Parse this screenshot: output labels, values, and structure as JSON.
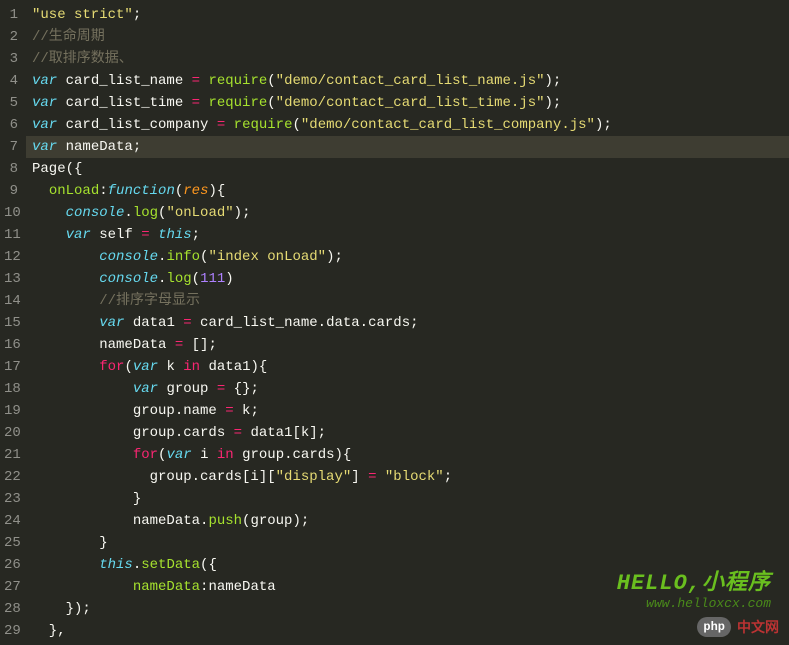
{
  "gutter": {
    "start": 1,
    "end": 29,
    "highlighted": 7
  },
  "code": {
    "lines": [
      [
        [
          "s-str",
          "\"use strict\""
        ],
        [
          "s-id",
          ";"
        ]
      ],
      [
        [
          "s-com",
          "//生命周期"
        ]
      ],
      [
        [
          "s-com",
          "//取排序数据、"
        ]
      ],
      [
        [
          "s-kw",
          "var"
        ],
        [
          "s-id",
          " card_list_name "
        ],
        [
          "s-op",
          "="
        ],
        [
          "s-id",
          " "
        ],
        [
          "s-func",
          "require"
        ],
        [
          "s-id",
          "("
        ],
        [
          "s-str",
          "\"demo/contact_card_list_name.js\""
        ],
        [
          "s-id",
          ");"
        ]
      ],
      [
        [
          "s-kw",
          "var"
        ],
        [
          "s-id",
          " card_list_time "
        ],
        [
          "s-op",
          "="
        ],
        [
          "s-id",
          " "
        ],
        [
          "s-func",
          "require"
        ],
        [
          "s-id",
          "("
        ],
        [
          "s-str",
          "\"demo/contact_card_list_time.js\""
        ],
        [
          "s-id",
          ");"
        ]
      ],
      [
        [
          "s-kw",
          "var"
        ],
        [
          "s-id",
          " card_list_company "
        ],
        [
          "s-op",
          "="
        ],
        [
          "s-id",
          " "
        ],
        [
          "s-func",
          "require"
        ],
        [
          "s-id",
          "("
        ],
        [
          "s-str",
          "\"demo/contact_card_list_company.js\""
        ],
        [
          "s-id",
          ");"
        ]
      ],
      [
        [
          "s-kw",
          "var"
        ],
        [
          "s-id",
          " nameData;"
        ]
      ],
      [
        [
          "s-id",
          "Page({"
        ]
      ],
      [
        [
          "s-id",
          "  "
        ],
        [
          "s-func",
          "onLoad"
        ],
        [
          "s-id",
          ":"
        ],
        [
          "s-kw",
          "function"
        ],
        [
          "s-id",
          "("
        ],
        [
          "s-orange",
          "res"
        ],
        [
          "s-id",
          "){"
        ]
      ],
      [
        [
          "s-id",
          "    "
        ],
        [
          "s-kw",
          "console"
        ],
        [
          "s-id",
          "."
        ],
        [
          "s-func",
          "log"
        ],
        [
          "s-id",
          "("
        ],
        [
          "s-str",
          "\"onLoad\""
        ],
        [
          "s-id",
          ");"
        ]
      ],
      [
        [
          "s-id",
          "    "
        ],
        [
          "s-kw",
          "var"
        ],
        [
          "s-id",
          " self "
        ],
        [
          "s-op",
          "="
        ],
        [
          "s-id",
          " "
        ],
        [
          "s-kw",
          "this"
        ],
        [
          "s-id",
          ";"
        ]
      ],
      [
        [
          "s-id",
          "        "
        ],
        [
          "s-kw",
          "console"
        ],
        [
          "s-id",
          "."
        ],
        [
          "s-func",
          "info"
        ],
        [
          "s-id",
          "("
        ],
        [
          "s-str",
          "\"index onLoad\""
        ],
        [
          "s-id",
          ");"
        ]
      ],
      [
        [
          "s-id",
          "        "
        ],
        [
          "s-kw",
          "console"
        ],
        [
          "s-id",
          "."
        ],
        [
          "s-func",
          "log"
        ],
        [
          "s-id",
          "("
        ],
        [
          "s-num",
          "111"
        ],
        [
          "s-id",
          ")"
        ]
      ],
      [
        [
          "s-id",
          "        "
        ],
        [
          "s-com",
          "//排序字母显示"
        ]
      ],
      [
        [
          "s-id",
          "        "
        ],
        [
          "s-kw",
          "var"
        ],
        [
          "s-id",
          " data1 "
        ],
        [
          "s-op",
          "="
        ],
        [
          "s-id",
          " card_list_name.data.cards;"
        ]
      ],
      [
        [
          "s-id",
          "        nameData "
        ],
        [
          "s-op",
          "="
        ],
        [
          "s-id",
          " [];"
        ]
      ],
      [
        [
          "s-id",
          "        "
        ],
        [
          "s-op",
          "for"
        ],
        [
          "s-id",
          "("
        ],
        [
          "s-kw",
          "var"
        ],
        [
          "s-id",
          " k "
        ],
        [
          "s-op",
          "in"
        ],
        [
          "s-id",
          " data1){"
        ]
      ],
      [
        [
          "s-id",
          "            "
        ],
        [
          "s-kw",
          "var"
        ],
        [
          "s-id",
          " group "
        ],
        [
          "s-op",
          "="
        ],
        [
          "s-id",
          " {};"
        ]
      ],
      [
        [
          "s-id",
          "            group.name "
        ],
        [
          "s-op",
          "="
        ],
        [
          "s-id",
          " k;"
        ]
      ],
      [
        [
          "s-id",
          "            group.cards "
        ],
        [
          "s-op",
          "="
        ],
        [
          "s-id",
          " data1[k];"
        ]
      ],
      [
        [
          "s-id",
          "            "
        ],
        [
          "s-op",
          "for"
        ],
        [
          "s-id",
          "("
        ],
        [
          "s-kw",
          "var"
        ],
        [
          "s-id",
          " i "
        ],
        [
          "s-op",
          "in"
        ],
        [
          "s-id",
          " group.cards){"
        ]
      ],
      [
        [
          "s-id",
          "              group.cards[i]["
        ],
        [
          "s-str",
          "\"display\""
        ],
        [
          "s-id",
          "] "
        ],
        [
          "s-op",
          "="
        ],
        [
          "s-id",
          " "
        ],
        [
          "s-str",
          "\"block\""
        ],
        [
          "s-id",
          ";"
        ]
      ],
      [
        [
          "s-id",
          "            }"
        ]
      ],
      [
        [
          "s-id",
          "            nameData."
        ],
        [
          "s-func",
          "push"
        ],
        [
          "s-id",
          "(group);"
        ]
      ],
      [
        [
          "s-id",
          "        }"
        ]
      ],
      [
        [
          "s-id",
          "        "
        ],
        [
          "s-kw",
          "this"
        ],
        [
          "s-id",
          "."
        ],
        [
          "s-func",
          "setData"
        ],
        [
          "s-id",
          "({"
        ]
      ],
      [
        [
          "s-id",
          "            "
        ],
        [
          "s-func",
          "nameData"
        ],
        [
          "s-id",
          ":nameData"
        ]
      ],
      [
        [
          "s-id",
          "    });"
        ]
      ],
      [
        [
          "s-id",
          "  },"
        ]
      ]
    ]
  },
  "watermark": {
    "line1": "HELLO,小程序",
    "line2": "www.helloxcx.com"
  },
  "badge": {
    "php": "php",
    "cn": "中文网"
  }
}
